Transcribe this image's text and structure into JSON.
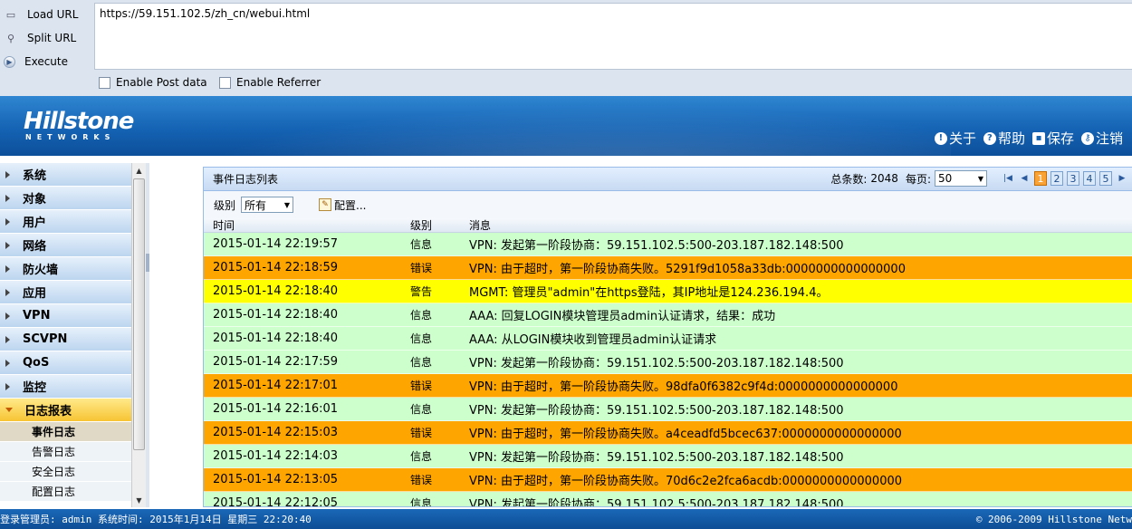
{
  "hackbar": {
    "buttons": [
      {
        "label": "Load URL",
        "icon": "load-url-icon"
      },
      {
        "label": "Split URL",
        "icon": "split-url-icon"
      },
      {
        "label": "Execute",
        "icon": "execute-icon"
      }
    ],
    "url": "https://59.151.102.5/zh_cn/webui.html",
    "enable_post": "Enable Post data",
    "enable_referrer": "Enable Referrer"
  },
  "header": {
    "brand": "Hillstone",
    "brand_sub": "NETWORKS",
    "links": {
      "about": "关于",
      "help": "帮助",
      "save": "保存",
      "logout": "注销"
    }
  },
  "sidebar": {
    "items": [
      {
        "label": "系统"
      },
      {
        "label": "对象"
      },
      {
        "label": "用户"
      },
      {
        "label": "网络"
      },
      {
        "label": "防火墙"
      },
      {
        "label": "应用"
      },
      {
        "label": "VPN"
      },
      {
        "label": "SCVPN"
      },
      {
        "label": "QoS"
      },
      {
        "label": "监控"
      },
      {
        "label": "日志报表"
      }
    ],
    "subitems": [
      {
        "label": "事件日志"
      },
      {
        "label": "告警日志"
      },
      {
        "label": "安全日志"
      },
      {
        "label": "配置日志"
      }
    ]
  },
  "panel": {
    "title": "事件日志列表",
    "total_label": "总条数:",
    "total": "2048",
    "per_page_label": "每页:",
    "per_page": "50",
    "pages": [
      "1",
      "2",
      "3",
      "4",
      "5"
    ],
    "current_page": "1",
    "level_label": "级别",
    "level_value": "所有",
    "config_label": "配置...",
    "columns": {
      "time": "时间",
      "level": "级别",
      "message": "消息"
    },
    "rows": [
      {
        "time": "2015-01-14 22:19:57",
        "level": "信息",
        "message": "VPN: 发起第一阶段协商：59.151.102.5:500-203.187.182.148:500",
        "type": "info"
      },
      {
        "time": "2015-01-14 22:18:59",
        "level": "错误",
        "message": "VPN: 由于超时，第一阶段协商失败。5291f9d1058a33db:0000000000000000",
        "type": "error"
      },
      {
        "time": "2015-01-14 22:18:40",
        "level": "警告",
        "message": "MGMT: 管理员\"admin\"在https登陆，其IP地址是124.236.194.4。",
        "type": "warn"
      },
      {
        "time": "2015-01-14 22:18:40",
        "level": "信息",
        "message": "AAA: 回复LOGIN模块管理员admin认证请求，结果：成功",
        "type": "info"
      },
      {
        "time": "2015-01-14 22:18:40",
        "level": "信息",
        "message": "AAA: 从LOGIN模块收到管理员admin认证请求",
        "type": "info"
      },
      {
        "time": "2015-01-14 22:17:59",
        "level": "信息",
        "message": "VPN: 发起第一阶段协商：59.151.102.5:500-203.187.182.148:500",
        "type": "info"
      },
      {
        "time": "2015-01-14 22:17:01",
        "level": "错误",
        "message": "VPN: 由于超时，第一阶段协商失败。98dfa0f6382c9f4d:0000000000000000",
        "type": "error"
      },
      {
        "time": "2015-01-14 22:16:01",
        "level": "信息",
        "message": "VPN: 发起第一阶段协商：59.151.102.5:500-203.187.182.148:500",
        "type": "info"
      },
      {
        "time": "2015-01-14 22:15:03",
        "level": "错误",
        "message": "VPN: 由于超时，第一阶段协商失败。a4ceadfd5bcec637:0000000000000000",
        "type": "error"
      },
      {
        "time": "2015-01-14 22:14:03",
        "level": "信息",
        "message": "VPN: 发起第一阶段协商：59.151.102.5:500-203.187.182.148:500",
        "type": "info"
      },
      {
        "time": "2015-01-14 22:13:05",
        "level": "错误",
        "message": "VPN: 由于超时，第一阶段协商失败。70d6c2e2fca6acdb:0000000000000000",
        "type": "error"
      },
      {
        "time": "2015-01-14 22:12:05",
        "level": "信息",
        "message": "VPN: 发起第一阶段协商：59.151.102.5:500-203.187.182.148:500",
        "type": "info"
      }
    ]
  },
  "status": {
    "left": "登录管理员: admin 系统时间: 2015年1月14日 星期三 22:20:40",
    "right": "© 2006-2009 Hillstone Netw"
  },
  "colors": {
    "info": "#ccffcc",
    "error": "#ffa500",
    "warn": "#ffff00",
    "current_page": "#f9a235"
  }
}
